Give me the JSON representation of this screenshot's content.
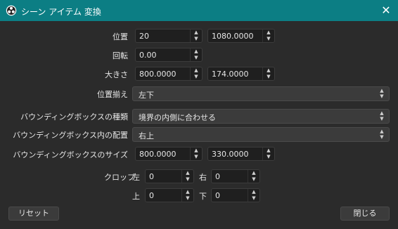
{
  "window": {
    "title": "シーン アイテム 変換",
    "close_label": "✕"
  },
  "position": {
    "label": "位置",
    "x": "20",
    "y": "1080.0000"
  },
  "rotation": {
    "label": "回転",
    "value": "0.00"
  },
  "size": {
    "label": "大きさ",
    "width": "800.0000",
    "height": "174.0000"
  },
  "alignment": {
    "label": "位置揃え",
    "value": "左下"
  },
  "bounds_type": {
    "label": "バウンディングボックスの種類",
    "value": "境界の内側に合わせる"
  },
  "bounds_alignment": {
    "label": "バウンディングボックス内の配置",
    "value": "右上"
  },
  "bounds_size": {
    "label": "バウンディングボックスのサイズ",
    "width": "800.0000",
    "height": "330.0000"
  },
  "crop": {
    "label": "クロップ",
    "left_label": "左",
    "left": "0",
    "right_label": "右",
    "right": "0",
    "top_label": "上",
    "top": "0",
    "bottom_label": "下",
    "bottom": "0"
  },
  "buttons": {
    "reset": "リセット",
    "close": "閉じる"
  },
  "icons": {
    "app": "obs-logo-icon",
    "spin_up": "▲",
    "spin_down": "▼"
  }
}
